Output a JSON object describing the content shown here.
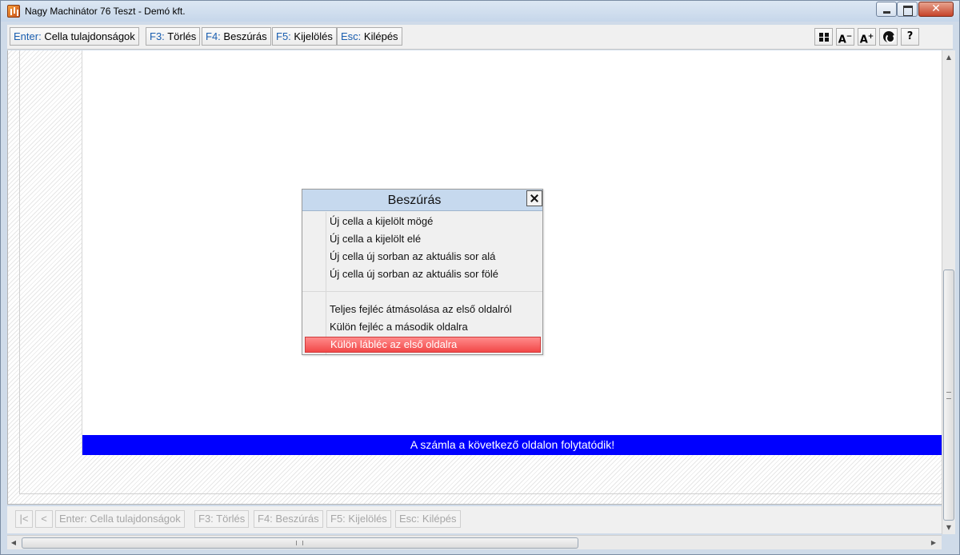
{
  "window": {
    "title": "Nagy Machinátor 76 Teszt - Demó kft."
  },
  "toolbar": {
    "buttons": [
      {
        "key": "Enter:",
        "label": "Cella tulajdonságok"
      },
      {
        "key": "F3:",
        "label": "Törlés"
      },
      {
        "key": "F4:",
        "label": "Beszúrás"
      },
      {
        "key": "F5:",
        "label": "Kijelölés"
      },
      {
        "key": "Esc:",
        "label": "Kilépés"
      }
    ],
    "icons": {
      "font_decrease": "A",
      "font_increase": "A",
      "help": "?"
    }
  },
  "page": {
    "footer_text": "A számla a következő oldalon folytatódik!",
    "footer_color": "#0000ff"
  },
  "popup": {
    "title": "Beszúrás",
    "items": [
      {
        "label": "Új cella a kijelölt mögé"
      },
      {
        "label": "Új cella a kijelölt elé"
      },
      {
        "label": "Új cella új sorban az aktuális sor alá"
      },
      {
        "label": "Új cella új sorban az aktuális sor fölé"
      },
      {
        "label": "Teljes fejléc átmásolása az első oldalról"
      },
      {
        "label": "Külön fejléc a második oldalra"
      },
      {
        "label": "Külön lábléc az első oldalra"
      }
    ],
    "selected_index": 6,
    "selected_color": "#f24848"
  },
  "bottombar": {
    "buttons": [
      {
        "label": "Enter: Cella tulajdonságok"
      },
      {
        "label": "F3: Törlés"
      },
      {
        "label": "F4: Beszúrás"
      },
      {
        "label": "F5: Kijelölés"
      },
      {
        "label": "Esc: Kilépés"
      }
    ]
  }
}
